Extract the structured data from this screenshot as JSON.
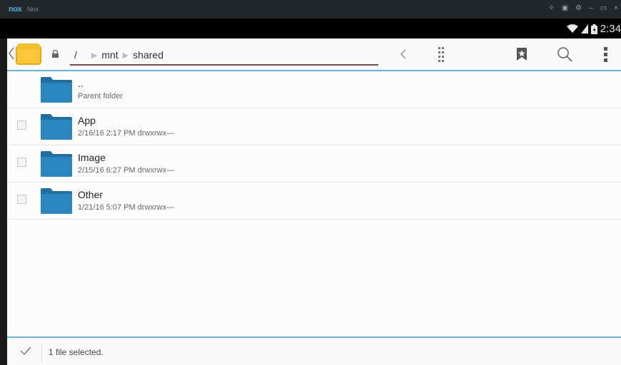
{
  "emulator": {
    "logo": "nox",
    "title": "Nox"
  },
  "status_bar": {
    "time": "2:34"
  },
  "toolbar": {
    "breadcrumb": [
      {
        "label": "/"
      },
      {
        "label": "mnt"
      },
      {
        "label": "shared"
      }
    ]
  },
  "files": [
    {
      "name": "..",
      "meta": "Parent folder",
      "has_checkbox": false
    },
    {
      "name": "App",
      "meta": "2/16/16 2:17 PM  drwxrwx—",
      "has_checkbox": true
    },
    {
      "name": "Image",
      "meta": "2/15/16 6:27 PM  drwxrwx—",
      "has_checkbox": true
    },
    {
      "name": "Other",
      "meta": "1/21/16 5:07 PM  drwxrwx—",
      "has_checkbox": true
    }
  ],
  "bottom_bar": {
    "status": "1 file selected."
  },
  "colors": {
    "accent": "#66b3e0",
    "folder": "#2a86c0",
    "app_icon": "#f4b81c"
  }
}
